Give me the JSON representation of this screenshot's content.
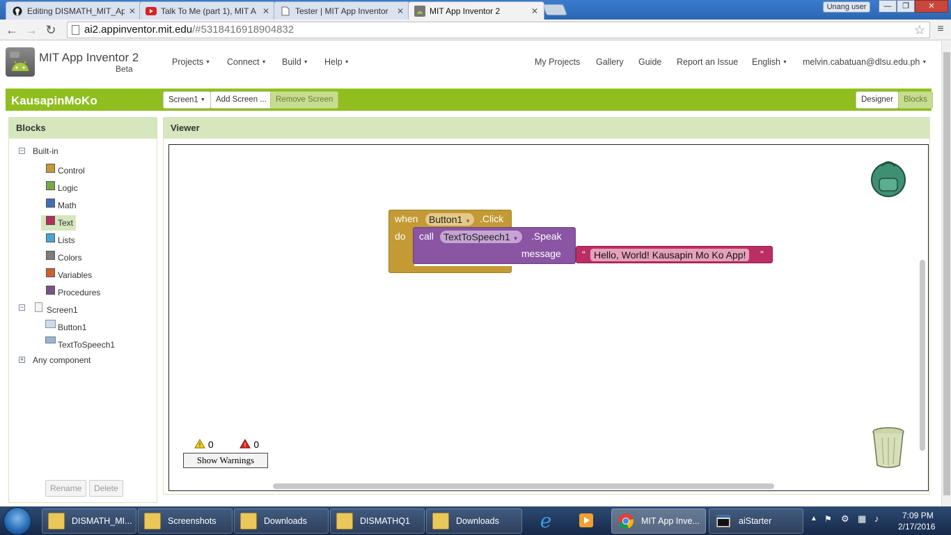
{
  "browser": {
    "tabs": [
      {
        "title": "Editing DISMATH_MIT_Ap",
        "icon": "github-icon"
      },
      {
        "title": "Talk To Me (part 1), MIT A",
        "icon": "youtube-icon"
      },
      {
        "title": "Tester | MIT App Inventor",
        "icon": "page-icon"
      },
      {
        "title": "MIT App Inventor 2",
        "icon": "appinventor-icon"
      }
    ],
    "profile_label": "Unang user",
    "url_host": "ai2.appinventor.mit.edu",
    "url_path": "/#5318416918904832"
  },
  "header": {
    "title": "MIT App Inventor 2",
    "subtitle": "Beta",
    "menus": [
      "Projects",
      "Connect",
      "Build",
      "Help"
    ],
    "links": [
      "My Projects",
      "Gallery",
      "Guide",
      "Report an Issue"
    ],
    "language": "English",
    "account": "melvin.cabatuan@dlsu.edu.ph"
  },
  "project_bar": {
    "name": "KausapinMoKo",
    "screen_select": "Screen1",
    "add_screen": "Add Screen ...",
    "remove_screen": "Remove Screen",
    "designer": "Designer",
    "blocks": "Blocks"
  },
  "blocks_panel": {
    "heading": "Blocks",
    "builtin": "Built-in",
    "categories": [
      {
        "label": "Control",
        "color": "#c39a34"
      },
      {
        "label": "Logic",
        "color": "#77ab41"
      },
      {
        "label": "Math",
        "color": "#3f71b5"
      },
      {
        "label": "Text",
        "color": "#b32d5e"
      },
      {
        "label": "Lists",
        "color": "#49a6d4"
      },
      {
        "label": "Colors",
        "color": "#7d7d7d"
      },
      {
        "label": "Variables",
        "color": "#d05f2d"
      },
      {
        "label": "Procedures",
        "color": "#7c5385"
      }
    ],
    "screen": "Screen1",
    "components": [
      "Button1",
      "TextToSpeech1"
    ],
    "any_component": "Any component",
    "rename": "Rename",
    "delete": "Delete"
  },
  "viewer": {
    "heading": "Viewer",
    "event_block": {
      "when": "when",
      "component": "Button1",
      "event": ".Click",
      "do": "do"
    },
    "call_block": {
      "call": "call",
      "component": "TextToSpeech1",
      "method": ".Speak",
      "param": "message"
    },
    "text_block": {
      "open_quote": "“",
      "value": "Hello, World! Kausapin Mo Ko App!",
      "close_quote": "”"
    },
    "warnings_count": "0",
    "errors_count": "0",
    "show_warnings": "Show Warnings"
  },
  "taskbar": {
    "items": [
      "DISMATH_MI...",
      "Screenshots",
      "Downloads",
      "DISMATHQ1",
      "Downloads",
      "MIT App Inve...",
      "aiStarter"
    ],
    "time": "7:09 PM",
    "date": "2/17/2016"
  }
}
